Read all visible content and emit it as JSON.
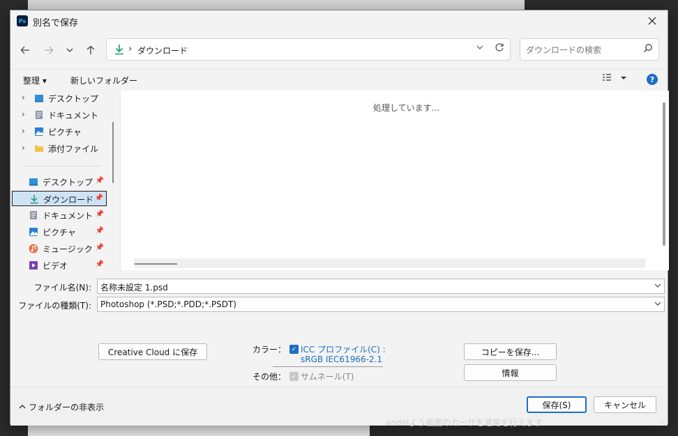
{
  "dialog": {
    "title": "別名で保存",
    "app_badge": "Ps"
  },
  "nav": {
    "path_label": "ダウンロード",
    "search_placeholder": "ダウンロードの検索"
  },
  "toolbar": {
    "organize": "整理 ▾",
    "new_folder": "新しいフォルダー"
  },
  "tree": [
    {
      "label": "デスクトップ",
      "icon": "desktop-icon"
    },
    {
      "label": "ドキュメント",
      "icon": "document-icon"
    },
    {
      "label": "ピクチャ",
      "icon": "pictures-icon"
    },
    {
      "label": "添付ファイル",
      "icon": "folder-icon"
    }
  ],
  "quick_access": [
    {
      "label": "デスクトップ",
      "icon": "desktop-icon",
      "selected": false
    },
    {
      "label": "ダウンロード",
      "icon": "download-icon",
      "selected": true
    },
    {
      "label": "ドキュメント",
      "icon": "document-icon",
      "selected": false
    },
    {
      "label": "ピクチャ",
      "icon": "pictures-icon",
      "selected": false
    },
    {
      "label": "ミュージック",
      "icon": "music-icon",
      "selected": false
    },
    {
      "label": "ビデオ",
      "icon": "video-icon",
      "selected": false
    }
  ],
  "content": {
    "status": "処理しています..."
  },
  "form": {
    "filename_label": "ファイル名(N):",
    "filename_value": "名称未設定 1.psd",
    "filetype_label": "ファイルの種類(T):",
    "filetype_value": "Photoshop (*.PSD;*.PDD;*.PSDT)"
  },
  "options": {
    "cc_button": "Creative Cloud に保存",
    "color_label": "カラー：",
    "icc_label": "ICC プロファイル(C) :",
    "icc_value": "sRGB IEC61966-2.1",
    "other_label": "その他：",
    "thumbnail_label": "サムネール(T)",
    "copy_button": "コピーを保存...",
    "info_button": "情報"
  },
  "footer": {
    "hide_folders": "フォルダーの非表示",
    "save": "保存(S)",
    "cancel": "キャンセル"
  },
  "background": {
    "text": "a​ndelよう画面のカ​ーサを​適用を​行えます"
  },
  "colors": {
    "accent": "#1b6ec2",
    "download_green": "#1a9b6a"
  }
}
